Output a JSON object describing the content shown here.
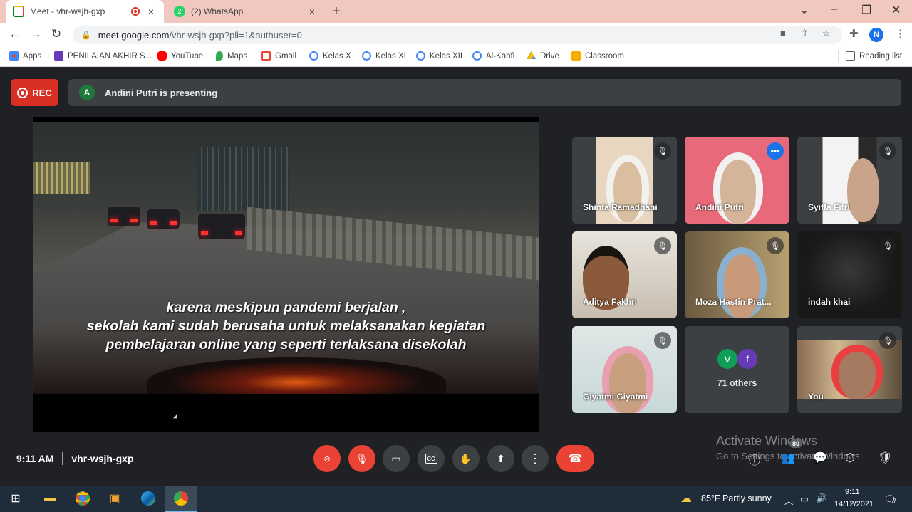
{
  "browser": {
    "tabs": [
      {
        "title": "Meet - vhr-wsjh-gxp",
        "recording": true
      },
      {
        "title": "(2) WhatsApp"
      }
    ],
    "new_tab_glyph": "+",
    "close_glyph": "×",
    "url_host": "meet.google.com",
    "url_path": "/vhr-wsjh-gxp?pli=1&authuser=0",
    "profile_initial": "N",
    "bookmarks": [
      {
        "label": "Apps",
        "icon": "apps-grid-icon",
        "color": "#4285f4"
      },
      {
        "label": "PENILAIAN AKHIR S...",
        "icon": "forms-icon",
        "color": "#673ab7"
      },
      {
        "label": "YouTube",
        "icon": "youtube-icon",
        "color": "#ff0000"
      },
      {
        "label": "Maps",
        "icon": "maps-icon",
        "color": "#34a853"
      },
      {
        "label": "Gmail",
        "icon": "gmail-icon",
        "color": "#ea4335"
      },
      {
        "label": "Kelas X",
        "icon": "google-icon",
        "color": "#4285f4"
      },
      {
        "label": "Kelas XI",
        "icon": "google-icon",
        "color": "#4285f4"
      },
      {
        "label": "Kelas XII",
        "icon": "google-icon",
        "color": "#4285f4"
      },
      {
        "label": "Al-Kahfi",
        "icon": "google-icon",
        "color": "#4285f4"
      },
      {
        "label": "Drive",
        "icon": "drive-icon",
        "color": "#fbbc04"
      },
      {
        "label": "Classroom",
        "icon": "classroom-icon",
        "color": "#f9ab00"
      }
    ],
    "reading_list": "Reading list"
  },
  "meet": {
    "rec_label": "REC",
    "presenter_initial": "A",
    "presenting_text": "Andini Putri is presenting",
    "subtitles": [
      "karena meskipun pandemi berjalan ,",
      "sekolah kami sudah berusaha untuk melaksanakan kegiatan",
      "pembelajaran online yang seperti terlaksana disekolah"
    ],
    "participants": [
      {
        "name": "Shinta Ramadhani",
        "muted": true
      },
      {
        "name": "Andini Putri",
        "muted": false,
        "speaking": true
      },
      {
        "name": "Syiffa Fitri",
        "muted": true
      },
      {
        "name": "Aditya Fakhri",
        "muted": true
      },
      {
        "name": "Moza Hastin Prat...",
        "muted": true
      },
      {
        "name": "indah khai",
        "muted": true
      },
      {
        "name": "Giyatmi Giyatmi",
        "muted": true
      },
      {
        "name": "You",
        "muted": true
      }
    ],
    "others": {
      "avatars": [
        "V",
        "f"
      ],
      "label": "71 others"
    },
    "time": "9:11 AM",
    "meeting_code": "vhr-wsjh-gxp",
    "people_count": "80",
    "watermark_title": "Activate Windows",
    "watermark_sub": "Go to Settings to activate Windows."
  },
  "taskbar": {
    "weather": "85°F  Partly sunny",
    "clock_time": "9:11",
    "clock_date": "14/12/2021",
    "notifications": "7"
  }
}
